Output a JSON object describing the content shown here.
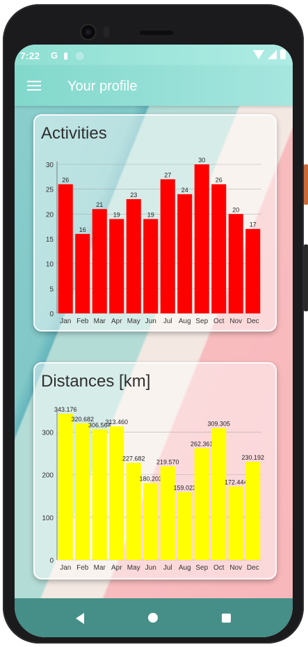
{
  "status_bar": {
    "time": "7:22",
    "icons": [
      "G",
      "clipboard-icon",
      "sync-icon"
    ]
  },
  "app_bar": {
    "title": "Your profile",
    "menu_icon": "menu-icon"
  },
  "cards": {
    "activities": {
      "title": "Activities"
    },
    "distances": {
      "title": "Distances [km]"
    }
  },
  "chart_data": [
    {
      "type": "bar",
      "title": "Activities",
      "categories": [
        "Jan",
        "Feb",
        "Mar",
        "Apr",
        "May",
        "Jun",
        "Jul",
        "Aug",
        "Sep",
        "Oct",
        "Nov",
        "Dec"
      ],
      "values": [
        26,
        16,
        21,
        19,
        23,
        19,
        27,
        24,
        30,
        26,
        20,
        17
      ],
      "value_labels": [
        "26",
        "16",
        "21",
        "19",
        "23",
        "19",
        "27",
        "24",
        "30",
        "26",
        "20",
        "17"
      ],
      "ylim": [
        0,
        30
      ],
      "yticks": [
        "0",
        "5",
        "10",
        "15",
        "20",
        "25",
        "30"
      ],
      "bar_color": "#ff0000",
      "grid": true
    },
    {
      "type": "bar",
      "title": "Distances [km]",
      "categories": [
        "Jan",
        "Feb",
        "Mar",
        "Apr",
        "May",
        "Jun",
        "Jul",
        "Aug",
        "Sep",
        "Oct",
        "Nov",
        "Dec"
      ],
      "values": [
        343.176,
        320.682,
        306.564,
        313.46,
        227.682,
        180.203,
        219.57,
        159.023,
        262.361,
        309.305,
        172.444,
        230.192
      ],
      "value_labels": [
        "343.176",
        "320.682",
        "306.564",
        "313.460",
        "227.682",
        "180.203",
        "219.570",
        "159.023",
        "262.361",
        "309.305",
        "172.444",
        "230.192"
      ],
      "ylim": [
        0,
        343.176
      ],
      "yticks": [
        "0",
        "100",
        "200",
        "300"
      ],
      "ytick_values": [
        0,
        100,
        200,
        300
      ],
      "bar_color": "#ffff00",
      "grid": true
    }
  ],
  "nav_bar": {
    "buttons": [
      "back-icon",
      "home-icon",
      "recent-apps-icon"
    ]
  }
}
